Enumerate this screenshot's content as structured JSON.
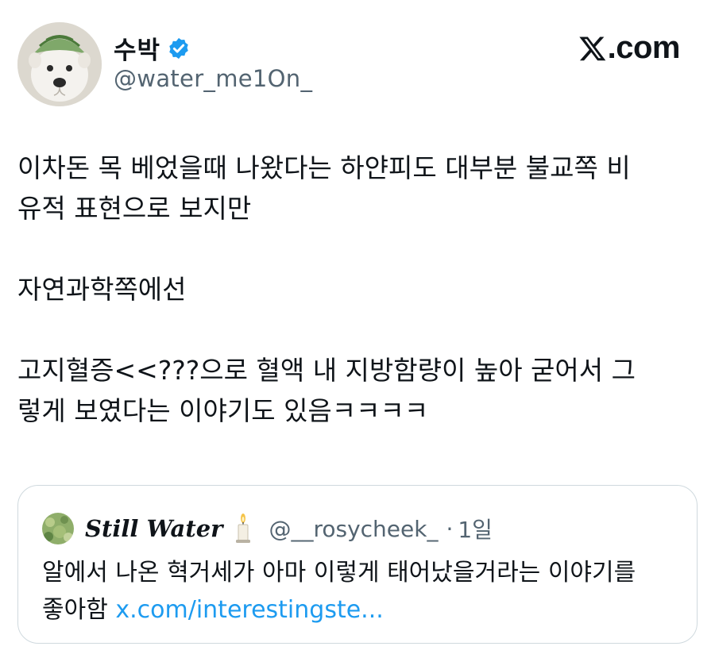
{
  "author": {
    "display_name": "수박",
    "handle": "@water_me1On_",
    "verified": true
  },
  "brand": {
    "label": ".com"
  },
  "tweet": {
    "paragraphs": [
      [
        "이차돈 목 베었을때 나왔다는 하얀피도 대부분 불교쪽 비",
        "유적 표현으로 보지만"
      ],
      [
        "자연과학쪽에선"
      ],
      [
        "고지혈증<<???으로 혈액 내 지방함량이 높아 굳어서 그",
        "렇게 보였다는 이야기도 있음ㅋㅋㅋㅋ"
      ]
    ]
  },
  "quote": {
    "display_name": "Still Water",
    "handle": "@__rosycheek_",
    "separator": "·",
    "time": "1일",
    "text_line1": "알에서 나온 혁거세가 아마 이렇게 태어났을거라는 이야기를",
    "text_line2": "좋아함",
    "link": "x.com/interestingste..."
  },
  "colors": {
    "text": "#0f1419",
    "secondary": "#536471",
    "verified": "#1d9bf0",
    "link": "#1d9bf0",
    "border": "#cfd9de"
  },
  "icons": [
    "avatar-dog-watermelon-hat",
    "verified-badge-icon",
    "x-logo-icon",
    "quote-avatar-green",
    "candle-icon"
  ]
}
